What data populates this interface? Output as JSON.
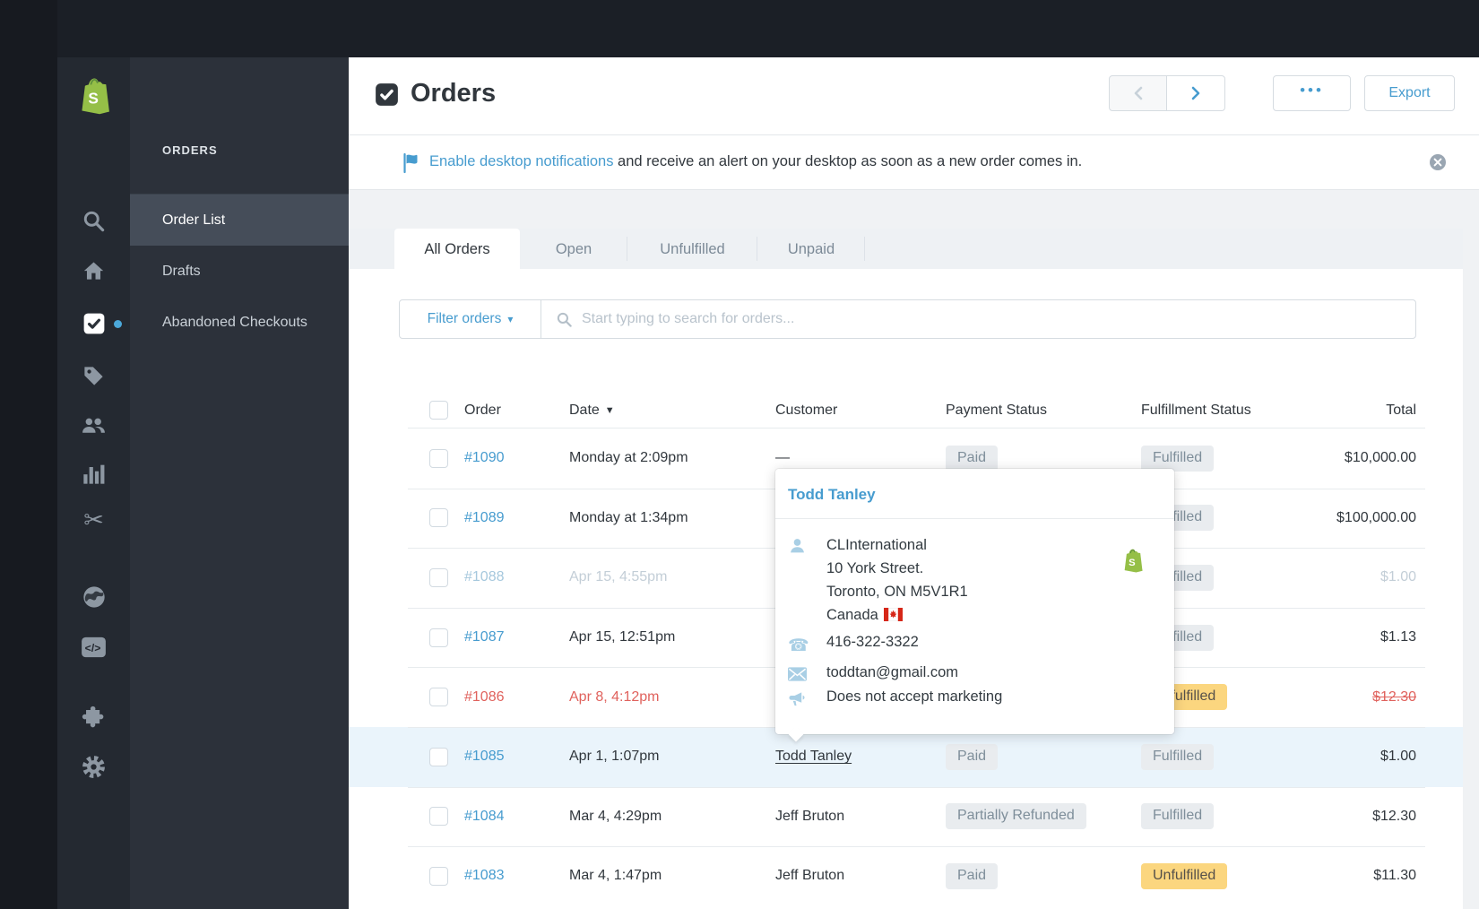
{
  "app": {
    "accent_blue": "#479ccf",
    "brand_green": "#95bf47",
    "warning_yellow": "#fbd67f",
    "alert_red": "#e0625d"
  },
  "sidebar": {
    "nav_title": "ORDERS",
    "items": [
      {
        "label": "Order List",
        "active": true
      },
      {
        "label": "Drafts",
        "active": false
      },
      {
        "label": "Abandoned Checkouts",
        "active": false
      }
    ]
  },
  "iconbar": {
    "icons": [
      "shopify-logo",
      "search",
      "home",
      "orders",
      "products-tag",
      "customers",
      "analytics",
      "discounts-scissors",
      "online-store-globe",
      "code",
      "apps-puzzle",
      "settings-gear"
    ],
    "glyphs": {
      "discounts-scissors": "✂",
      "settings-gear": "⚙",
      "caret-down": "▾"
    }
  },
  "header": {
    "title": "Orders",
    "more_label": "•••",
    "export_label": "Export"
  },
  "banner": {
    "link_text": "Enable desktop notifications",
    "rest_text": " and receive an alert on your desktop as soon as a new order comes in."
  },
  "tabs": [
    {
      "label": "All Orders",
      "active": true
    },
    {
      "label": "Open",
      "active": false
    },
    {
      "label": "Unfulfilled",
      "active": false
    },
    {
      "label": "Unpaid",
      "active": false
    }
  ],
  "filter": {
    "button_label": "Filter orders",
    "search_placeholder": "Start typing to search for orders..."
  },
  "table": {
    "columns": {
      "order": "Order",
      "date": "Date",
      "customer": "Customer",
      "payment": "Payment Status",
      "fulfillment": "Fulfillment Status",
      "total": "Total"
    },
    "rows": [
      {
        "order": "#1090",
        "date": "Monday at 2:09pm",
        "customer": "—",
        "payment": "Paid",
        "fulfillment": "Fulfilled",
        "total": "$10,000.00"
      },
      {
        "order": "#1089",
        "date": "Monday at 1:34pm",
        "customer": "",
        "payment": "",
        "fulfillment": "Fulfilled",
        "total": "$100,000.00"
      },
      {
        "order": "#1088",
        "date": "Apr 15, 4:55pm",
        "customer": "",
        "payment": "",
        "fulfillment": "Fulfilled",
        "total": "$1.00",
        "state": "muted"
      },
      {
        "order": "#1087",
        "date": "Apr 15, 12:51pm",
        "customer": "",
        "payment": "",
        "fulfillment": "Fulfilled",
        "total": "$1.13"
      },
      {
        "order": "#1086",
        "date": "Apr 8, 4:12pm",
        "customer": "",
        "payment": "",
        "fulfillment": "Unfulfilled",
        "fulfillment_warning": true,
        "total": "$12.30",
        "state": "alert",
        "total_strike": true
      },
      {
        "order": "#1085",
        "date": "Apr 1, 1:07pm",
        "customer": "Todd Tanley",
        "customer_underline": true,
        "payment": "Paid",
        "fulfillment": "Fulfilled",
        "total": "$1.00",
        "state": "selected"
      },
      {
        "order": "#1084",
        "date": "Mar 4, 4:29pm",
        "customer": "Jeff Bruton",
        "payment": "Partially Refunded",
        "fulfillment": "Fulfilled",
        "total": "$12.30"
      },
      {
        "order": "#1083",
        "date": "Mar 4, 1:47pm",
        "customer": "Jeff Bruton",
        "payment": "Paid",
        "fulfillment": "Unfulfilled",
        "fulfillment_warning": true,
        "total": "$11.30"
      }
    ]
  },
  "customer_popover": {
    "name": "Todd Tanley",
    "company": "CLInternational",
    "address_line1": "10 York Street.",
    "address_line2": "Toronto, ON M5V1R1",
    "country": "Canada",
    "phone": "416-322-3322",
    "email": "toddtan@gmail.com",
    "marketing": "Does not accept marketing"
  }
}
